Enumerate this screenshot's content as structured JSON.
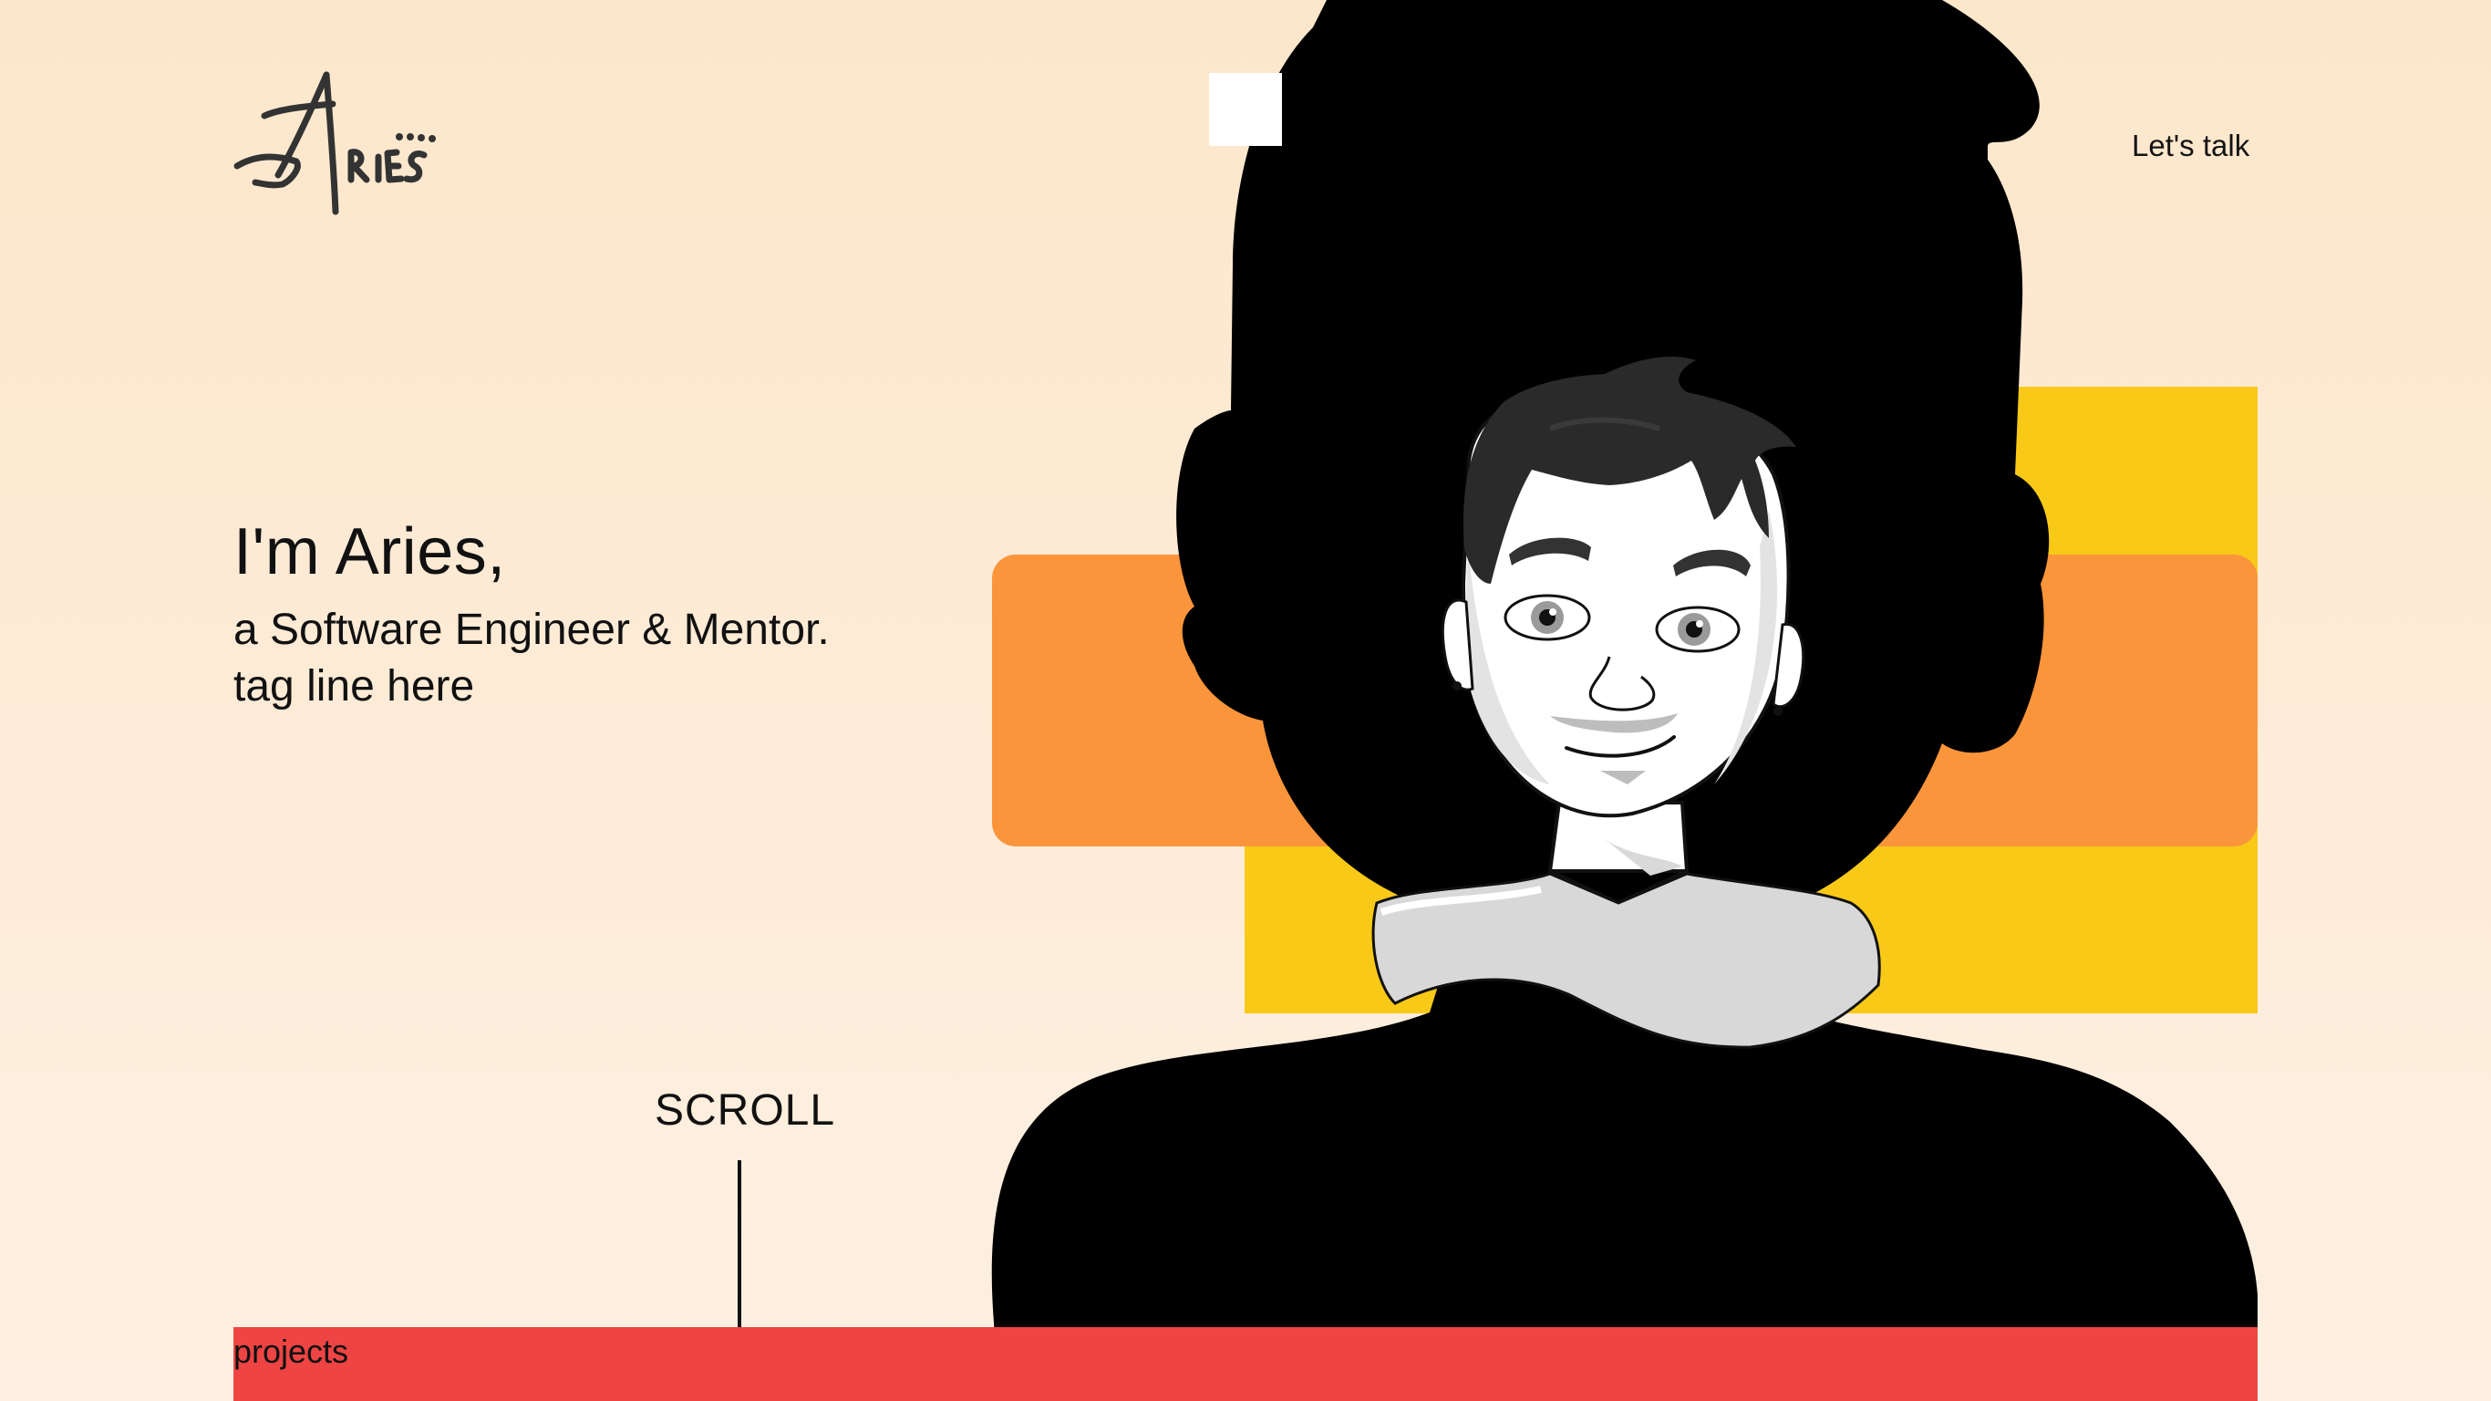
{
  "brand": {
    "logo_text": "Aries"
  },
  "nav": {
    "cta_label": "Let's talk"
  },
  "hero": {
    "title": "I'm Aries,",
    "subtitle": "a Software Engineer & Mentor.",
    "tagline": "tag line here"
  },
  "scroll": {
    "label": "SCROLL"
  },
  "bottom_bar": {
    "label": "projects"
  },
  "colors": {
    "background": "#fde7cb",
    "orange_block": "#fb953b",
    "yellow_block": "#f8c917",
    "red_bar": "#ef4444",
    "silhouette": "#000000"
  },
  "icons": {
    "logo": "aries-signature-logo",
    "avatar": "avatar-illustration"
  }
}
